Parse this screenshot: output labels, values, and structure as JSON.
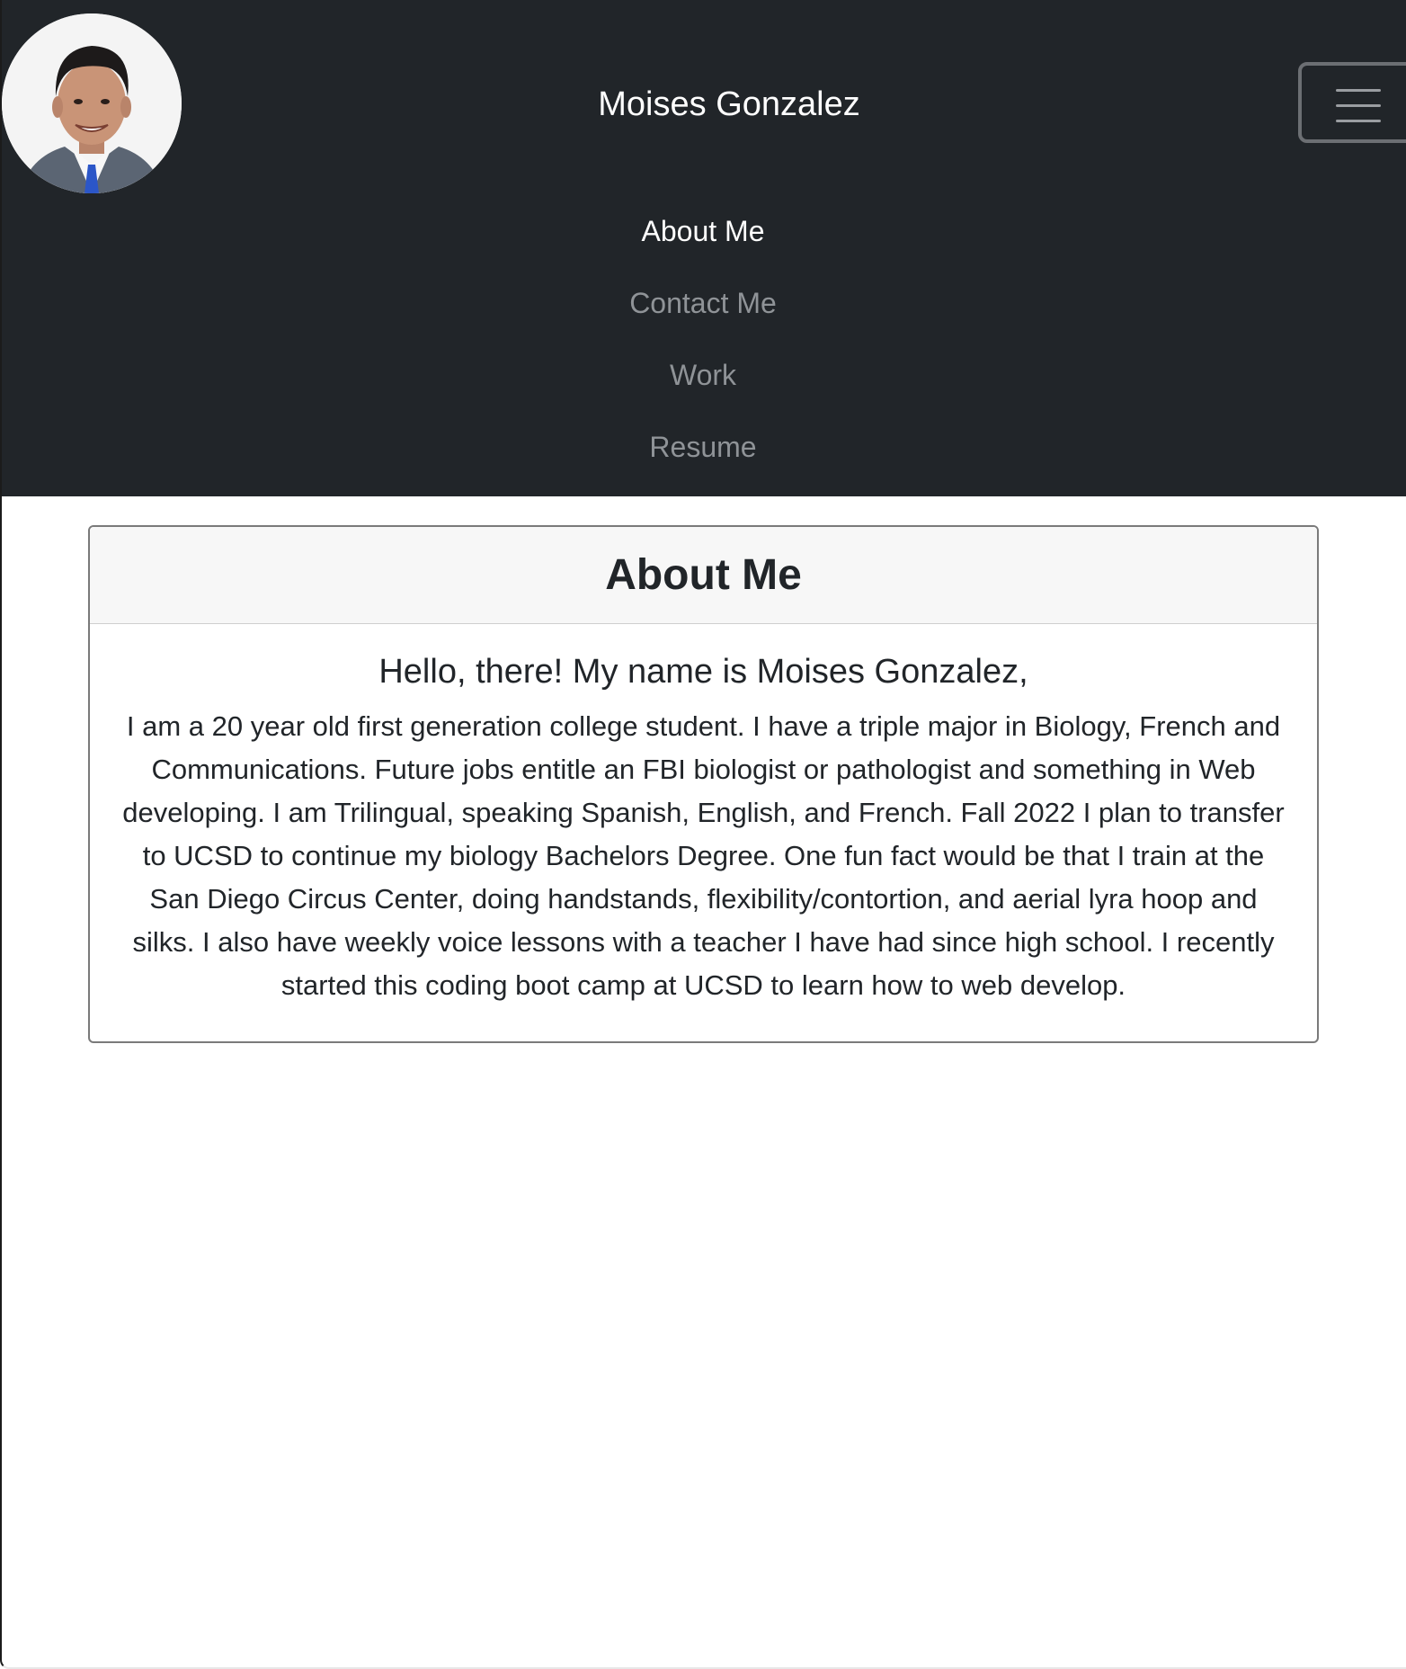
{
  "header": {
    "brand_name": "Moises Gonzalez",
    "avatar_icon": "profile-photo",
    "menu_icon": "hamburger-icon",
    "background_color": "#212529"
  },
  "nav": {
    "items": [
      {
        "label": "About Me",
        "active": true
      },
      {
        "label": "Contact Me",
        "active": false
      },
      {
        "label": "Work",
        "active": false
      },
      {
        "label": "Resume",
        "active": false
      }
    ]
  },
  "about": {
    "title": "About Me",
    "greeting": "Hello, there! My name is Moises Gonzalez,",
    "bio": "I am a 20 year old first generation college student. I have a triple major in Biology, French and Communications. Future jobs entitle an FBI biologist or pathologist and something in Web developing. I am Trilingual, speaking Spanish, English, and French. Fall 2022 I plan to transfer to UCSD to continue my biology Bachelors Degree. One fun fact would be that I train at the San Diego Circus Center, doing handstands, flexibility/contortion, and aerial lyra hoop and silks. I also have weekly voice lessons with a teacher I have had since high school. I recently started this coding boot camp at UCSD to learn how to web develop."
  }
}
